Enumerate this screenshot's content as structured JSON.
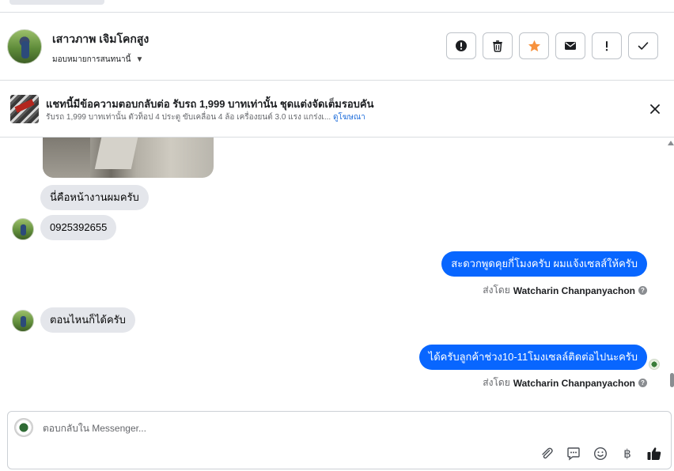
{
  "header": {
    "contact_name": "เสาวภาพ เจิมโคกสูง",
    "assign_label": "มอบหมายการสนทนานี้",
    "actions": [
      {
        "name": "spam-button",
        "icon": "alert-circle-icon"
      },
      {
        "name": "delete-button",
        "icon": "trash-icon"
      },
      {
        "name": "star-button",
        "icon": "star-icon"
      },
      {
        "name": "mark-unread-button",
        "icon": "envelope-icon"
      },
      {
        "name": "follow-up-button",
        "icon": "exclamation-icon"
      },
      {
        "name": "mark-done-button",
        "icon": "check-icon"
      }
    ],
    "star_color": "#f7923e"
  },
  "ad_banner": {
    "title": "แชทนี้มีข้อความตอบกลับต่อ รับรถ 1,999 บาทเท่านั้น ชุดแต่งจัดเต็มรอบคัน",
    "subtitle": "รับรถ 1,999 บาทเท่านั้น ตัวท็อป 4 ประตู ขับเคลื่อน 4 ล้อ เครื่องยนต์ 3.0 แรง แกร่งเ...",
    "link": "ดูโฆษณา"
  },
  "messages": [
    {
      "direction": "in",
      "text": "นี่คือหน้างานผมครับ"
    },
    {
      "direction": "in",
      "text": "0925392655"
    },
    {
      "direction": "out",
      "text": "สะดวกพูดคุยกี่โมงครับ ผมแจ้งเซลส์ให้ครับ",
      "sent_by_label": "ส่งโดย",
      "sent_by": "Watcharin Chanpanyachon"
    },
    {
      "direction": "in",
      "text": "ตอนไหนก็ได้ครับ"
    },
    {
      "direction": "out",
      "text": "ได้ครับลูกค้าช่วง10-11โมงเซลล์ติดต่อไปนะครับ",
      "sent_by_label": "ส่งโดย",
      "sent_by": "Watcharin Chanpanyachon"
    }
  ],
  "composer": {
    "placeholder": "ตอบกลับใน Messenger...",
    "tools": [
      "paperclip-icon",
      "saved-reply-icon",
      "emoji-icon",
      "baht-icon",
      "thumbs-up-icon"
    ],
    "baht_glyph": "฿"
  },
  "colors": {
    "outgoing_bubble": "#0866ff",
    "incoming_bubble": "#e4e6eb",
    "link": "#216fdb"
  }
}
